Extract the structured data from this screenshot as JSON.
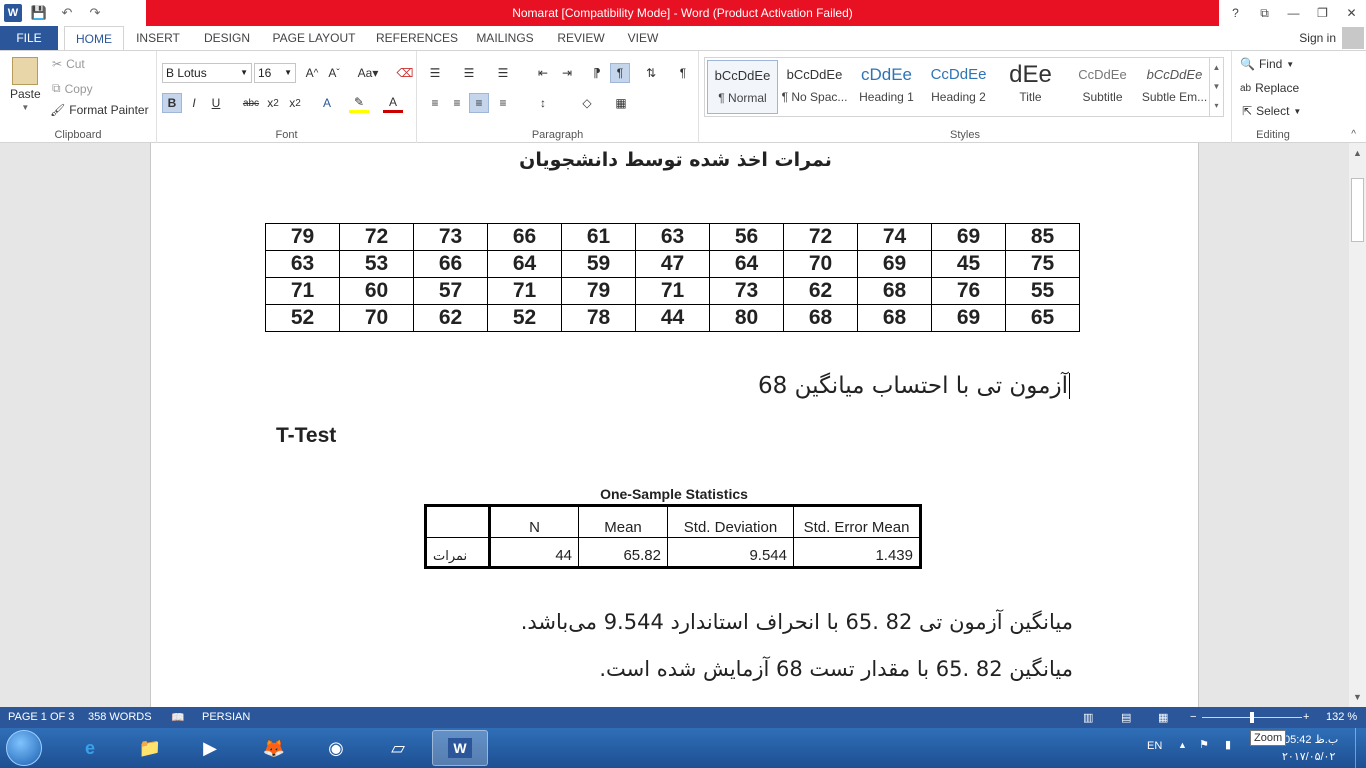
{
  "window": {
    "title": "Nomarat [Compatibility Mode] -  Word (Product Activation Failed)",
    "controls": [
      "?",
      "⧉",
      "—",
      "❐",
      "✕"
    ]
  },
  "qat": {
    "save": "💾",
    "undo": "↶",
    "redo": "↷"
  },
  "tabs": [
    "FILE",
    "HOME",
    "INSERT",
    "DESIGN",
    "PAGE LAYOUT",
    "REFERENCES",
    "MAILINGS",
    "REVIEW",
    "VIEW"
  ],
  "signin": "Sign in",
  "clipboard": {
    "label": "Clipboard",
    "paste": "Paste",
    "cut": "Cut",
    "copy": "Copy",
    "format_painter": "Format Painter"
  },
  "font": {
    "label": "Font",
    "name": "B Lotus",
    "size": "16"
  },
  "paragraph": {
    "label": "Paragraph"
  },
  "styles": {
    "label": "Styles",
    "items": [
      {
        "sample": "bCcDdEe",
        "name": "¶ Normal"
      },
      {
        "sample": "bCcDdEe",
        "name": "¶ No Spac..."
      },
      {
        "sample": "cDdEe",
        "name": "Heading 1"
      },
      {
        "sample": "CcDdEe",
        "name": "Heading 2"
      },
      {
        "sample": "dEe",
        "name": "Title"
      },
      {
        "sample": "CcDdEe",
        "name": "Subtitle"
      },
      {
        "sample": "bCcDdEe",
        "name": "Subtle Em..."
      }
    ]
  },
  "editing": {
    "label": "Editing",
    "find": "Find",
    "replace": "Replace",
    "select": "Select"
  },
  "document": {
    "heading": "نمرات اخذ شده توسط دانشجویان",
    "grades": [
      [
        "79",
        "72",
        "73",
        "66",
        "61",
        "63",
        "56",
        "72",
        "74",
        "69",
        "85"
      ],
      [
        "63",
        "53",
        "66",
        "64",
        "59",
        "47",
        "64",
        "70",
        "69",
        "45",
        "75"
      ],
      [
        "71",
        "60",
        "57",
        "71",
        "79",
        "71",
        "73",
        "62",
        "68",
        "76",
        "55"
      ],
      [
        "52",
        "70",
        "62",
        "52",
        "78",
        "44",
        "80",
        "68",
        "68",
        "69",
        "65"
      ]
    ],
    "subheading": "آزمون تی با احتساب میانگین 68",
    "ttest": "T-Test",
    "oss_title": "One-Sample Statistics",
    "oss_headers": [
      "",
      "N",
      "Mean",
      "Std. Deviation",
      "Std. Error Mean"
    ],
    "oss_row": [
      "نمرات",
      "44",
      "65.82",
      "9.544",
      "1.439"
    ],
    "para1": "میانگین آزمون تی 82 .65 با انحراف استاندارد 9.544 می‌باشد.",
    "para2": "میانگین 82 .65 با مقدار تست 68 آزمایش شده است."
  },
  "status": {
    "page": "PAGE 1 OF 3",
    "words": "358 WORDS",
    "lang": "PERSIAN",
    "zoom": "132 %"
  },
  "tray": {
    "lang": "EN",
    "time": "ب.ظ 05:42",
    "date": "۲۰۱۷/۰۵/۰۲",
    "tooltip": "Zoom"
  }
}
